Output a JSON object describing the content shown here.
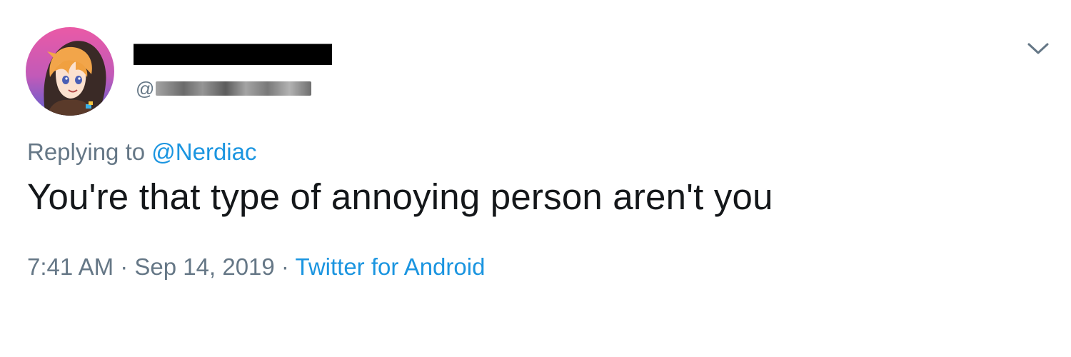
{
  "tweet": {
    "author": {
      "handle_prefix": "@",
      "avatar_icon": "anime-avatar-icon"
    },
    "menu_icon": "chevron-down-icon",
    "reply_prefix": "Replying to ",
    "reply_to": "@Nerdiac",
    "text": "You're that type of annoying person aren't you",
    "time": "7:41 AM",
    "separator": " · ",
    "date": "Sep 14, 2019",
    "source": "Twitter for Android"
  },
  "colors": {
    "link": "#1b95e0",
    "secondary_text": "#657786",
    "primary_text": "#14171a",
    "avatar_bg_top": "#e85aa8",
    "avatar_bg_bottom": "#6b5cc7"
  }
}
